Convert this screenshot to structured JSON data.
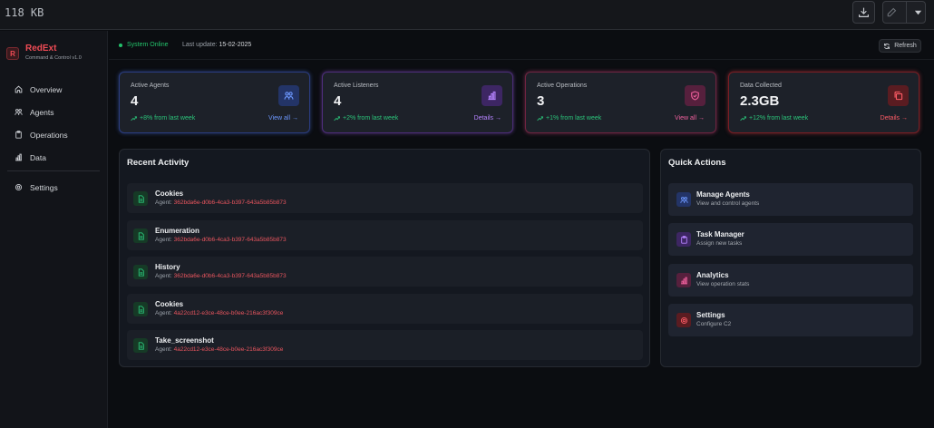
{
  "filebar": {
    "size": "118 KB"
  },
  "brand": {
    "logo": "R",
    "name": "RedExt",
    "subtitle": "Command & Control v1.0"
  },
  "nav": [
    {
      "label": "Overview",
      "icon": "home-icon"
    },
    {
      "label": "Agents",
      "icon": "users-icon"
    },
    {
      "label": "Operations",
      "icon": "clipboard-icon"
    },
    {
      "label": "Data",
      "icon": "bar-chart-icon"
    },
    {
      "label": "Settings",
      "icon": "gear-icon"
    }
  ],
  "topbar": {
    "status": "System Online",
    "last_update_label": "Last update:",
    "last_update": "15-02-2025",
    "refresh": "Refresh"
  },
  "stats": [
    {
      "label": "Active Agents",
      "value": "4",
      "change": "+8% from last week",
      "link": "View all →",
      "color": "#4f7df0",
      "icon": "users-icon"
    },
    {
      "label": "Active Listeners",
      "value": "4",
      "change": "+2% from last week",
      "link": "Details →",
      "color": "#a45ff0",
      "icon": "bar-chart-icon"
    },
    {
      "label": "Active Operations",
      "value": "3",
      "change": "+1% from last week",
      "link": "View all →",
      "color": "#e04b8a",
      "icon": "shield-icon"
    },
    {
      "label": "Data Collected",
      "value": "2.3GB",
      "change": "+12% from last week",
      "link": "Details →",
      "color": "#e5414b",
      "icon": "copy-icon"
    }
  ],
  "recent": {
    "title": "Recent Activity",
    "agent_label": "Agent:",
    "items": [
      {
        "name": "Cookies",
        "agent": "362bda6e-d0b6-4ca3-b397-643a5b85b873"
      },
      {
        "name": "Enumeration",
        "agent": "362bda6e-d0b6-4ca3-b397-643a5b85b873"
      },
      {
        "name": "History",
        "agent": "362bda6e-d0b6-4ca3-b397-643a5b85b873"
      },
      {
        "name": "Cookies",
        "agent": "4a22cd12-e3ce-48ce-b0ee-216ac3f309ce"
      },
      {
        "name": "Take_screenshot",
        "agent": "4a22cd12-e3ce-48ce-b0ee-216ac3f309ce"
      }
    ]
  },
  "quick": {
    "title": "Quick Actions",
    "items": [
      {
        "title": "Manage Agents",
        "sub": "View and control agents",
        "color": "#4f7df0",
        "icon": "users-icon"
      },
      {
        "title": "Task Manager",
        "sub": "Assign new tasks",
        "color": "#a45ff0",
        "icon": "clipboard-icon"
      },
      {
        "title": "Analytics",
        "sub": "View operation stats",
        "color": "#e04b8a",
        "icon": "bar-chart-icon"
      },
      {
        "title": "Settings",
        "sub": "Configure C2",
        "color": "#e5414b",
        "icon": "gear-icon"
      }
    ]
  }
}
